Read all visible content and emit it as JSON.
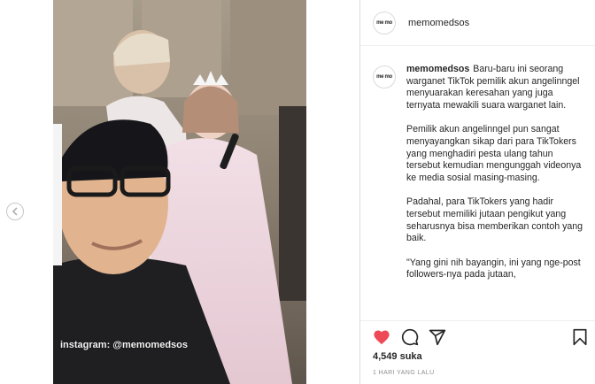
{
  "post": {
    "username": "memomedsos",
    "avatar_text": "me mo",
    "watermark": "instagram: @memomedsos",
    "caption_user": "memomedsos",
    "caption_paragraphs": [
      "Baru-baru ini seorang warganet TikTok pemilik akun angelinngel menyuarakan keresahan yang juga ternyata mewakili suara warganet lain.",
      "Pemilik akun angelinngel pun sangat menyayangkan sikap dari para TikTokers yang menghadiri pesta ulang tahun tersebut kemudian mengunggah videonya ke media sosial masing-masing.",
      "Padahal, para TikTokers yang hadir tersebut memiliki jutaan pengikut yang seharusnya bisa memberikan contoh yang baik.",
      "\"Yang gini nih bayangin, ini yang nge-post followers-nya pada jutaan,"
    ],
    "likes": "4,549 suka",
    "timestamp": "1 HARI YANG LALU"
  },
  "icons": {
    "prev": "chevron-left-icon",
    "like": "heart-icon",
    "comment": "comment-icon",
    "share": "send-icon",
    "save": "bookmark-icon"
  },
  "colors": {
    "like_active": "#ed4956",
    "border": "#dbdbdb",
    "muted_text": "#8e8e8e"
  }
}
